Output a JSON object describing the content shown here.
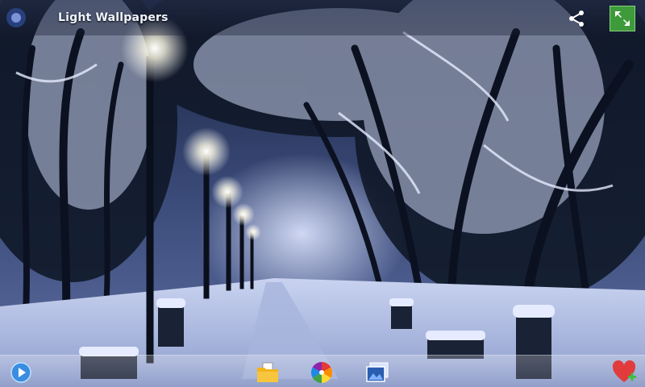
{
  "app": {
    "title": "Light Wallpapers"
  },
  "wallpaper": {
    "subject": "snowy-park-lampposts-night"
  },
  "topbar": {
    "share_icon": "share-icon",
    "fullscreen_icon": "expand-arrows-icon"
  },
  "bottombar": {
    "items": [
      {
        "name": "play-button",
        "icon": "play-globe-icon"
      },
      {
        "name": "folder-button",
        "icon": "folder-icon"
      },
      {
        "name": "color-wheel-button",
        "icon": "color-wheel-icon"
      },
      {
        "name": "gallery-button",
        "icon": "gallery-icon"
      },
      {
        "name": "favorite-add-button",
        "icon": "heart-plus-icon"
      }
    ]
  },
  "colors": {
    "fullscreen_bg": "#3e9a3a",
    "heart": "#e23b3b",
    "plus": "#3fbf3f"
  }
}
